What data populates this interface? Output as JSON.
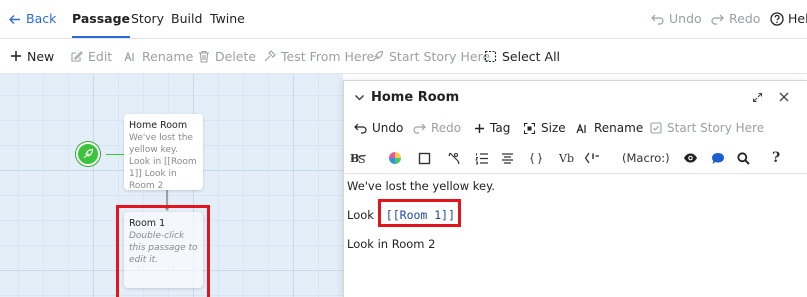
{
  "topbar": {
    "back": "Back",
    "tabs": [
      "Passage",
      "Story",
      "Build",
      "Twine"
    ],
    "undo": "Undo",
    "redo": "Redo",
    "help": "Help"
  },
  "toolbar": {
    "new": "New",
    "edit": "Edit",
    "rename": "Rename",
    "delete": "Delete",
    "test_from_here": "Test From Here",
    "start_story_here": "Start Story Here",
    "select_all": "Select All"
  },
  "map": {
    "passages": [
      {
        "title": "Home Room",
        "excerpt": "We've lost the yellow key. Look in [[Room 1]] Look in Room 2"
      },
      {
        "title": "Room 1",
        "excerpt": "Double-click this passage to edit it."
      }
    ]
  },
  "dialog": {
    "title": "Home Room",
    "toolbar": {
      "undo": "Undo",
      "redo": "Redo",
      "tag": "Tag",
      "size": "Size",
      "rename": "Rename",
      "start_story_here": "Start Story Here"
    },
    "format_toolbar": {
      "vb": "Vb",
      "macro": "(Macro:)",
      "question": "?"
    },
    "text": {
      "line1": "We've lost the yellow key.",
      "line2_prefix": "Look i",
      "line2_link": "[[Room 1]]",
      "line3": "Look in Room 2"
    }
  },
  "colors": {
    "accent": "#2b6cd4",
    "highlight": "#e2141c",
    "start_marker": "#3bc43b",
    "map_background": "#e4eef8",
    "link_text": "#2249a8"
  }
}
